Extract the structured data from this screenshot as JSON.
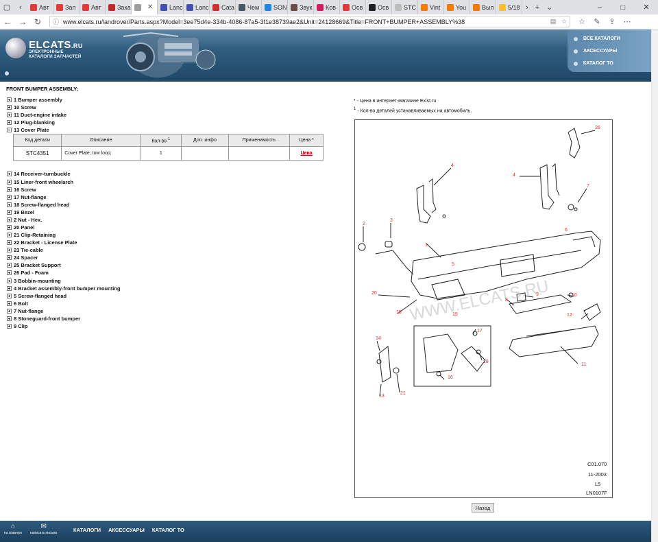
{
  "browser": {
    "tabs": [
      {
        "label": "Авт",
        "color": "#e53935"
      },
      {
        "label": "Зап",
        "color": "#e53935"
      },
      {
        "label": "Авт",
        "color": "#e53935"
      },
      {
        "label": "Зака",
        "color": "#c62828"
      },
      {
        "label": "",
        "color": "#9e9e9e",
        "active": true
      },
      {
        "label": "Lanc",
        "color": "#3f51b5"
      },
      {
        "label": "Lanc",
        "color": "#3f51b5"
      },
      {
        "label": "Cata",
        "color": "#d32f2f"
      },
      {
        "label": "Чем",
        "color": "#455a64"
      },
      {
        "label": "SON",
        "color": "#1e88e5"
      },
      {
        "label": "Звук",
        "color": "#6d4c41"
      },
      {
        "label": "Ков",
        "color": "#d81b60"
      },
      {
        "label": "Осв",
        "color": "#e53935"
      },
      {
        "label": "Осв",
        "color": "#212121"
      },
      {
        "label": "STC",
        "color": "#bdbdbd"
      },
      {
        "label": "Vint",
        "color": "#f57c00"
      },
      {
        "label": "You",
        "color": "#f57c00"
      },
      {
        "label": "Вып",
        "color": "#f57c00"
      },
      {
        "label": "5/18",
        "color": "#fbc02d"
      }
    ],
    "url": "www.elcats.ru/landrover/Parts.aspx?Model=3ee75d4e-334b-4086-87a5-3f1e38739ae2&Unit=24128669&Title=FRONT+BUMPER+ASSEMBLY%38"
  },
  "header": {
    "logo_text": "ELCATS",
    "logo_suffix": ".RU",
    "logo_subtitle": "ЭЛЕКТРОННЫЕ КАТАЛОГИ ЗАПЧАСТЕЙ",
    "links": [
      "ВСЕ КАТАЛОГИ",
      "АКСЕССУАРЫ",
      "КАТАЛОГ ТО"
    ]
  },
  "assembly": {
    "title": "FRONT BUMPER ASSEMBLY;",
    "items_before": [
      {
        "label": "1  Bumper assembly",
        "expanded": false
      },
      {
        "label": "10  Screw",
        "expanded": false
      },
      {
        "label": "11  Duct-engine intake",
        "expanded": false
      },
      {
        "label": "12  Plug-blanking",
        "expanded": false
      },
      {
        "label": "13  Cover Plate",
        "expanded": true
      }
    ],
    "items_after": [
      {
        "label": "14  Receiver-turnbuckle"
      },
      {
        "label": "15  Liner-front wheelarch"
      },
      {
        "label": "16  Screw"
      },
      {
        "label": "17  Nut-flange"
      },
      {
        "label": "18  Screw-flanged head"
      },
      {
        "label": "19  Bezel"
      },
      {
        "label": "2  Nut - Hex."
      },
      {
        "label": "20  Panel"
      },
      {
        "label": "21  Clip-Retaining"
      },
      {
        "label": "22  Bracket - License Plate"
      },
      {
        "label": "23  Tie-cable"
      },
      {
        "label": "24  Spacer"
      },
      {
        "label": "25  Bracket Support"
      },
      {
        "label": "26  Pad - Foam"
      },
      {
        "label": "3  Bobbin-mounting"
      },
      {
        "label": "4  Bracket assembly-front bumper mounting"
      },
      {
        "label": "5  Screw-flanged head"
      },
      {
        "label": "6  Bolt"
      },
      {
        "label": "7  Nut-flange"
      },
      {
        "label": "8  Stoneguard-front bumper"
      },
      {
        "label": "9  Clip"
      }
    ]
  },
  "table": {
    "headers": {
      "code": "Код детали",
      "desc": "Описание",
      "qty": "Кол-во",
      "qty_sup": "1",
      "info": "Доп. инфо",
      "apply": "Применимость",
      "price": "Цена *"
    },
    "row": {
      "code": "STC4351",
      "desc": "Cover Plate; tow loop;",
      "qty": "1",
      "info": "",
      "apply": "",
      "price": "Цена"
    }
  },
  "notes": {
    "star": "* - Цена в интернет-магазине Exist.ru",
    "one_sup": "1",
    "one": " - Кол-во деталей устанавливаемых на автомобиль."
  },
  "diagram": {
    "watermark": "WWW.ELCATS.RU",
    "code_lines": [
      "C01.070",
      "11-2003",
      "L5",
      "LN0107F"
    ],
    "callouts": [
      "26",
      "4",
      "4",
      "7",
      "6",
      "2",
      "3",
      "5",
      "1",
      "20",
      "19",
      "15",
      "9",
      "10",
      "8",
      "12",
      "17",
      "18",
      "16",
      "14",
      "13",
      "21",
      "11"
    ]
  },
  "back_button": "Назад",
  "footer": {
    "icon_home": "на главную",
    "icon_mail": "написать письмо",
    "nav": [
      "КАТАЛОГИ",
      "АКСЕССУАРЫ",
      "КАТАЛОГ ТО"
    ]
  }
}
